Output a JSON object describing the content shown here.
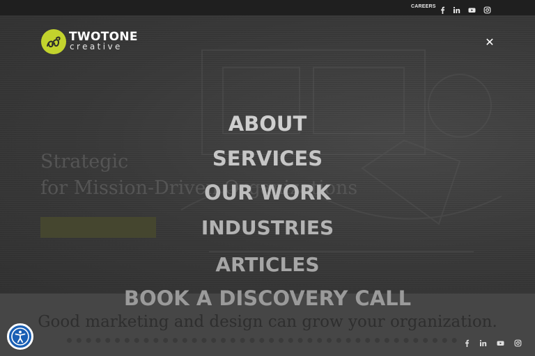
{
  "topbar": {
    "careers_label": "CAREERS",
    "social_icons": [
      "facebook-icon",
      "linkedin-icon",
      "youtube-icon",
      "instagram-icon"
    ]
  },
  "logo": {
    "brand_word": "TWOTONE",
    "brand_sub": "creative",
    "mark_color": "#c2d32d"
  },
  "hero": {
    "headline_line1": "Strategic",
    "headline_line2": "for Mission-Driven Organizations"
  },
  "lower": {
    "tagline": "Good marketing and design can grow your organization."
  },
  "nav": {
    "items": [
      "ABOUT",
      "SERVICES",
      "OUR WORK",
      "INDUSTRIES",
      "ARTICLES",
      "BOOK A DISCOVERY CALL"
    ]
  },
  "footer_social": {
    "icons": [
      "facebook-icon",
      "linkedin-icon",
      "youtube-icon",
      "instagram-icon"
    ]
  },
  "accessibility": {
    "icon": "accessibility-icon",
    "color": "#1a5fb4"
  }
}
